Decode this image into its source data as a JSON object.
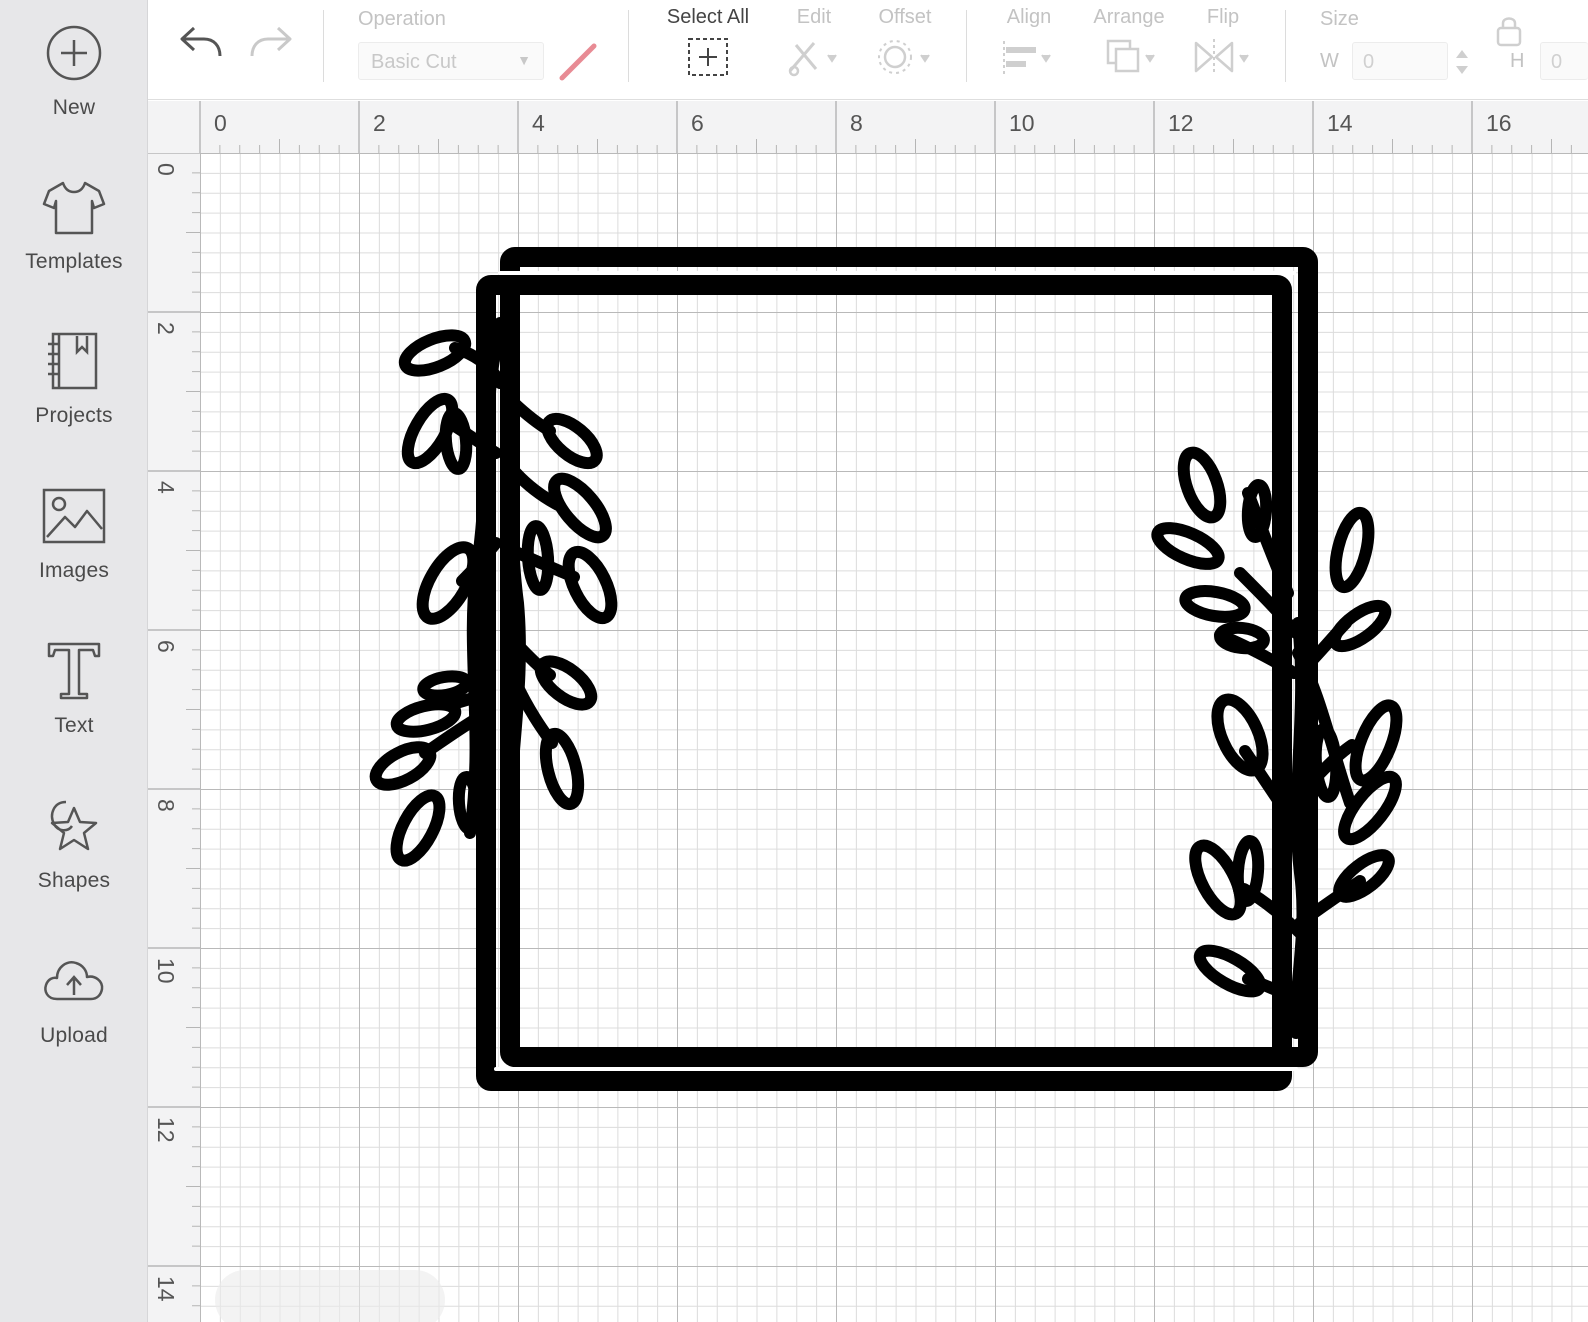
{
  "sidebar": {
    "items": [
      {
        "label": "New",
        "icon": "plus-circle-icon"
      },
      {
        "label": "Templates",
        "icon": "tshirt-icon"
      },
      {
        "label": "Projects",
        "icon": "notebook-icon"
      },
      {
        "label": "Images",
        "icon": "image-icon"
      },
      {
        "label": "Text",
        "icon": "text-t-icon"
      },
      {
        "label": "Shapes",
        "icon": "shapes-icon"
      },
      {
        "label": "Upload",
        "icon": "cloud-upload-icon"
      }
    ]
  },
  "toolbar": {
    "undo_icon": "undo-icon",
    "redo_icon": "redo-icon",
    "operation_label": "Operation",
    "operation_value": "Basic Cut",
    "select_all_label": "Select All",
    "edit_label": "Edit",
    "offset_label": "Offset",
    "align_label": "Align",
    "arrange_label": "Arrange",
    "flip_label": "Flip",
    "size_label": "Size",
    "width_label": "W",
    "width_value": "0",
    "height_label": "H",
    "height_value": "0"
  },
  "rulers": {
    "top": [
      "0",
      "2",
      "4",
      "6",
      "8",
      "10",
      "12",
      "14",
      "16"
    ],
    "left": [
      "0",
      "2",
      "4",
      "6",
      "8",
      "10",
      "12",
      "14"
    ]
  },
  "colors": {
    "sidebar_bg": "#e7e7e9",
    "pen_color": "#e88b94",
    "design_stroke": "#000000"
  }
}
